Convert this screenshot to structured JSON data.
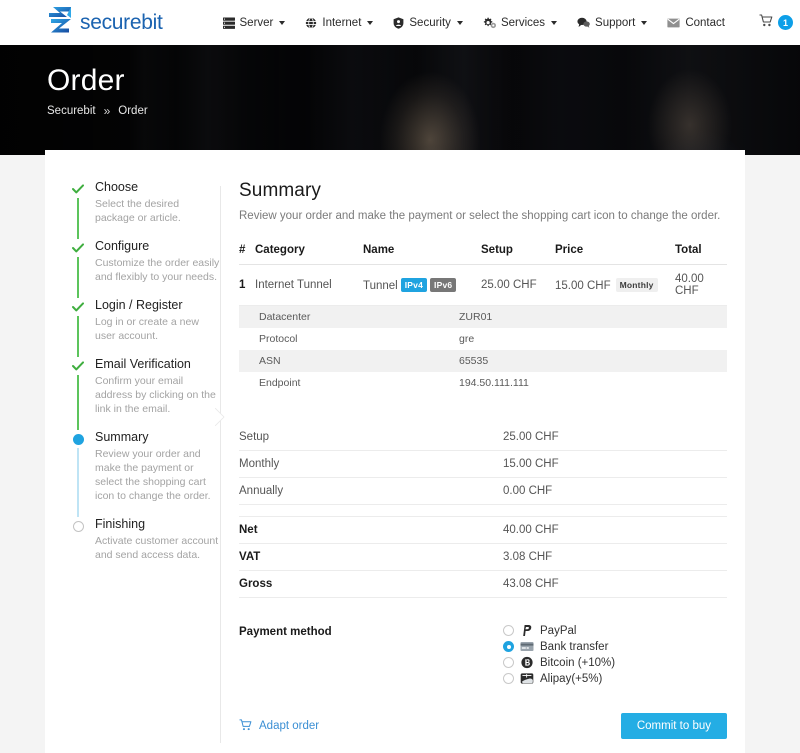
{
  "brand": {
    "name": "securebit",
    "logo_icon": "securebit-logo-icon",
    "color": "#1b63b0"
  },
  "nav": {
    "items": [
      {
        "label": "Server",
        "icon": "server-icon",
        "has_dropdown": true
      },
      {
        "label": "Internet",
        "icon": "globe-icon",
        "has_dropdown": true
      },
      {
        "label": "Security",
        "icon": "shield-icon",
        "has_dropdown": true
      },
      {
        "label": "Services",
        "icon": "gears-icon",
        "has_dropdown": true
      },
      {
        "label": "Support",
        "icon": "chat-icon",
        "has_dropdown": true
      },
      {
        "label": "Contact",
        "icon": "envelope-icon",
        "has_dropdown": false
      }
    ],
    "cart": {
      "icon": "cart-icon",
      "count": "1",
      "badge_color": "#0d9fe8"
    }
  },
  "hero": {
    "title": "Order",
    "breadcrumb": {
      "home": "Securebit",
      "separator": "»",
      "current": "Order"
    }
  },
  "steps": [
    {
      "title": "Choose",
      "desc": "Select the desired package or article.",
      "state": "done"
    },
    {
      "title": "Configure",
      "desc": "Customize the order easily and flexibly to your needs.",
      "state": "done"
    },
    {
      "title": "Login / Register",
      "desc": "Log in or create a new user account.",
      "state": "done"
    },
    {
      "title": "Email Verification",
      "desc": "Confirm your email address by clicking on the link in the email.",
      "state": "done"
    },
    {
      "title": "Summary",
      "desc": "Review your order and make the payment or select the shopping cart icon to change the order.",
      "state": "active"
    },
    {
      "title": "Finishing",
      "desc": "Activate customer account and send access data.",
      "state": "todo"
    }
  ],
  "summary": {
    "title": "Summary",
    "subtitle": "Review your order and make the payment or select the shopping cart icon to change the order."
  },
  "order_table": {
    "headers": [
      "#",
      "Category",
      "Name",
      "Setup",
      "Price",
      "Total"
    ],
    "rows": [
      {
        "num": "1",
        "category": "Internet Tunnel",
        "name": "Tunnel",
        "name_badges": [
          {
            "label": "IPv4",
            "color": "#1fa3e0"
          },
          {
            "label": "IPv6",
            "color": "#777777"
          }
        ],
        "setup": "25.00 CHF",
        "price": "15.00 CHF",
        "price_badge": "Monthly",
        "total": "40.00 CHF"
      }
    ]
  },
  "details": [
    {
      "key": "Datacenter",
      "value": "ZUR01"
    },
    {
      "key": "Protocol",
      "value": "gre"
    },
    {
      "key": "ASN",
      "value": "65535"
    },
    {
      "key": "Endpoint",
      "value": "194.50.111.111"
    }
  ],
  "pricing": {
    "recurring": [
      {
        "label": "Setup",
        "amount": "25.00 CHF"
      },
      {
        "label": "Monthly",
        "amount": "15.00 CHF"
      },
      {
        "label": "Annually",
        "amount": "0.00 CHF"
      }
    ],
    "totals": [
      {
        "label": "Net",
        "amount": "40.00 CHF"
      },
      {
        "label": "VAT",
        "amount": "3.08 CHF"
      },
      {
        "label": "Gross",
        "amount": "43.08 CHF"
      }
    ]
  },
  "payment": {
    "label": "Payment method",
    "options": [
      {
        "label": "PayPal",
        "icon": "paypal-icon",
        "selected": false
      },
      {
        "label": "Bank transfer",
        "icon": "card-icon",
        "selected": true
      },
      {
        "label": "Bitcoin (+10%)",
        "icon": "bitcoin-icon",
        "selected": false
      },
      {
        "label": "Alipay(+5%)",
        "icon": "alipay-icon",
        "selected": false
      }
    ]
  },
  "actions": {
    "adapt_label": "Adapt order",
    "adapt_icon": "cart-icon",
    "commit_label": "Commit to buy",
    "commit_color": "#24ade4"
  }
}
